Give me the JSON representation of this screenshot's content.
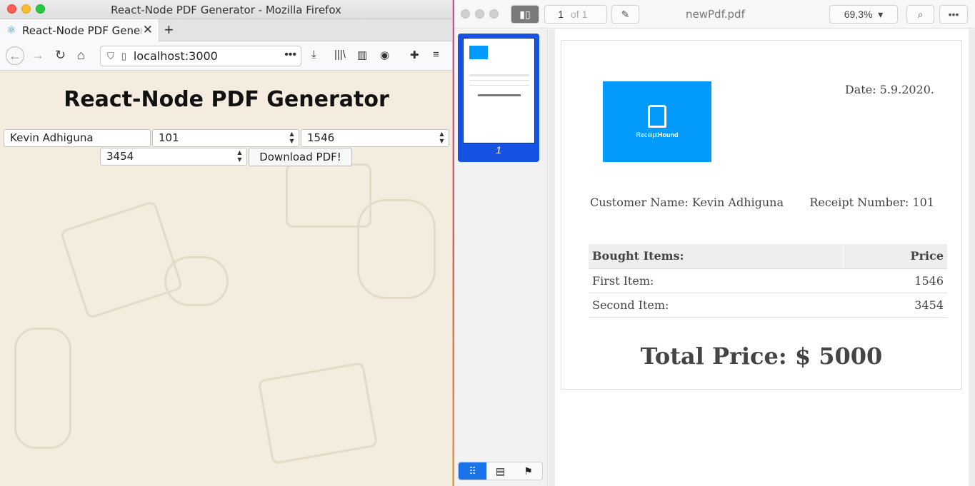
{
  "firefox": {
    "window_title": "React-Node PDF Generator - Mozilla Firefox",
    "tab_title": "React-Node PDF Genera",
    "url": "localhost:3000",
    "app": {
      "title": "React-Node PDF Generator",
      "name_value": "Kevin Adhiguna",
      "receipt_value": "101",
      "price1_value": "1546",
      "price2_value": "3454",
      "download_label": "Download PDF!"
    }
  },
  "viewer": {
    "page_current": "1",
    "page_total": "of 1",
    "filename": "newPdf.pdf",
    "zoom": "69,3%",
    "thumb_label": "1",
    "pdf": {
      "date": "Date: 5.9.2020.",
      "logo_text_light": "Receipt",
      "logo_text_bold": "Hound",
      "customer": "Customer Name: Kevin Adhiguna",
      "receipt_number": "Receipt Number: 101",
      "table": {
        "headers": [
          "Bought Items:",
          "Price"
        ],
        "rows": [
          [
            "First Item:",
            "1546"
          ],
          [
            "Second Item:",
            "3454"
          ]
        ]
      },
      "total": "Total Price: $ 5000"
    }
  },
  "colors": {
    "accent": "#1a73e8",
    "logo_bg": "#029bfb",
    "page_bg": "#f3ecdf"
  }
}
